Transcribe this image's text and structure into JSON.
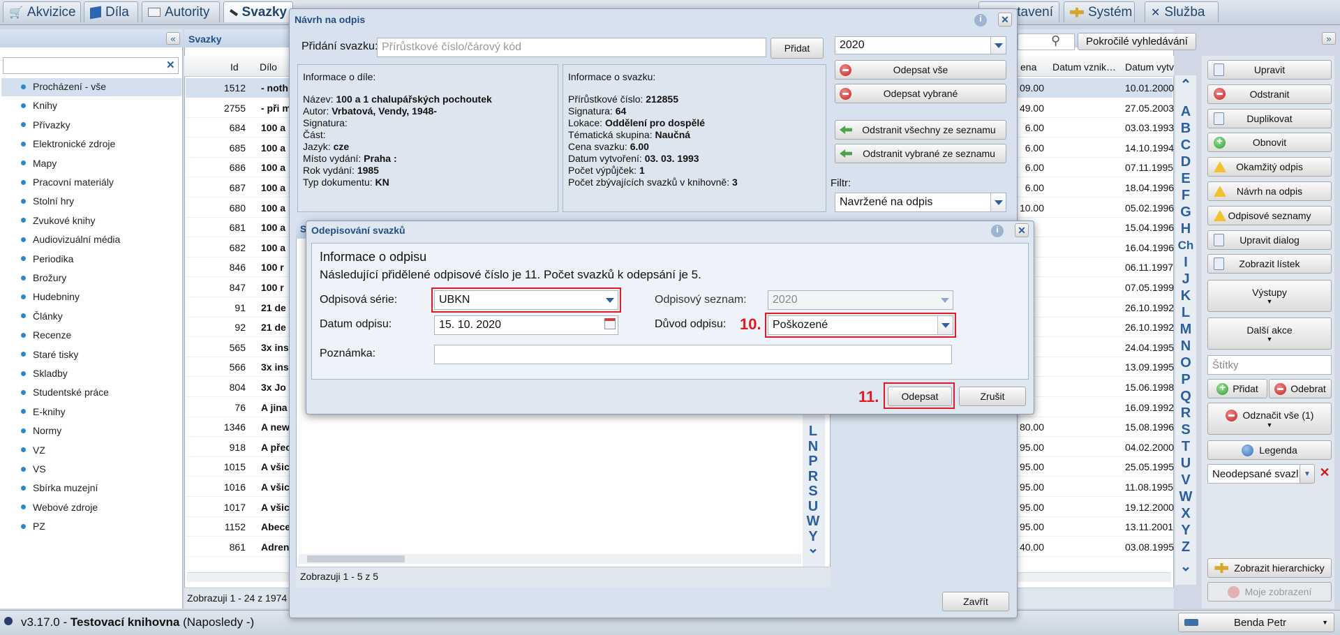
{
  "top_tabs": [
    {
      "label": "Akvizice",
      "icon": "cart-icon"
    },
    {
      "label": "Díla",
      "icon": "book-icon"
    },
    {
      "label": "Autority",
      "icon": "card-icon"
    },
    {
      "label": "Svazky",
      "icon": "pen-icon"
    }
  ],
  "top_tabs_right": [
    {
      "label": "stavení",
      "icon": "gear-icon"
    },
    {
      "label": "Systém",
      "icon": "key-icon"
    },
    {
      "label": "Služba",
      "icon": "tools-icon"
    }
  ],
  "sidebar": {
    "items": [
      "Procházení - vše",
      "Knihy",
      "Přívazky",
      "Elektronické zdroje",
      "Mapy",
      "Pracovní materiály",
      "Stolní hry",
      "Zvukové knihy",
      "Audiovizuální média",
      "Periodika",
      "Brožury",
      "Hudebniny",
      "Články",
      "Recenze",
      "Staré tisky",
      "Skladby",
      "Studentské práce",
      "E-knihy",
      "Normy",
      "VZ",
      "VS",
      "Sbírka muzejní",
      "Webové zdroje",
      "PZ"
    ]
  },
  "main": {
    "title": "Svazky",
    "columns": {
      "id": "Id",
      "dilo": "Dílo",
      "cena": "ena",
      "datum_vznik": "Datum vznik…",
      "datum_vytv": "Datum vytv"
    },
    "rows": [
      {
        "id": "1512",
        "dilo": "- noth",
        "cena": "09.00",
        "vytv": "10.01.2000"
      },
      {
        "id": "2755",
        "dilo": "- při m",
        "cena": "49.00",
        "vytv": "27.05.2003"
      },
      {
        "id": "684",
        "dilo": "100 a",
        "cena": "6.00",
        "vytv": "03.03.1993"
      },
      {
        "id": "685",
        "dilo": "100 a",
        "cena": "6.00",
        "vytv": "14.10.1994"
      },
      {
        "id": "686",
        "dilo": "100 a",
        "cena": "6.00",
        "vytv": "07.11.1995"
      },
      {
        "id": "687",
        "dilo": "100 a",
        "cena": "6.00",
        "vytv": "18.04.1996"
      },
      {
        "id": "680",
        "dilo": "100 a",
        "cena": "10.00",
        "vytv": "05.02.1996"
      },
      {
        "id": "681",
        "dilo": "100 a",
        "cena": "",
        "vytv": "15.04.1996"
      },
      {
        "id": "682",
        "dilo": "100 a",
        "cena": "",
        "vytv": "16.04.1996"
      },
      {
        "id": "846",
        "dilo": "100 r",
        "cena": "",
        "vytv": "06.11.1997"
      },
      {
        "id": "847",
        "dilo": "100 r",
        "cena": "",
        "vytv": "07.05.1999"
      },
      {
        "id": "91",
        "dilo": "21 de",
        "cena": "",
        "vytv": "26.10.1992"
      },
      {
        "id": "92",
        "dilo": "21 de",
        "cena": "",
        "vytv": "26.10.1992"
      },
      {
        "id": "565",
        "dilo": "3x ins",
        "cena": "",
        "vytv": "24.04.1995"
      },
      {
        "id": "566",
        "dilo": "3x ins",
        "cena": "",
        "vytv": "13.09.1995"
      },
      {
        "id": "804",
        "dilo": "3x Jo",
        "cena": "",
        "vytv": "15.06.1998"
      },
      {
        "id": "76",
        "dilo": "A jina",
        "cena": "",
        "vytv": "16.09.1992"
      },
      {
        "id": "1346",
        "dilo": "A new",
        "cena": "80.00",
        "vytv": "15.08.1996"
      },
      {
        "id": "918",
        "dilo": "A přec",
        "cena": "95.00",
        "vytv": "04.02.2000"
      },
      {
        "id": "1015",
        "dilo": "A všic",
        "cena": "95.00",
        "vytv": "25.05.1995"
      },
      {
        "id": "1016",
        "dilo": "A všic",
        "cena": "95.00",
        "vytv": "11.08.1995"
      },
      {
        "id": "1017",
        "dilo": "A všic",
        "cena": "95.00",
        "vytv": "19.12.2000"
      },
      {
        "id": "1152",
        "dilo": "Abece",
        "cena": "95.00",
        "vytv": "13.11.2001"
      },
      {
        "id": "861",
        "dilo": "Adren",
        "cena": "40.00",
        "vytv": "03.08.1995"
      }
    ],
    "footer": "Zobrazuji 1 - 24 z 1974"
  },
  "search": {
    "advanced_label": "Pokročilé vyhledávání"
  },
  "alphabet_outer": [
    "A",
    "B",
    "C",
    "D",
    "E",
    "F",
    "G",
    "H",
    "Ch",
    "I",
    "J",
    "K",
    "L",
    "M",
    "N",
    "O",
    "P",
    "Q",
    "R",
    "S",
    "T",
    "U",
    "V",
    "W",
    "X",
    "Y",
    "Z"
  ],
  "right_panel": {
    "buttons": [
      "Upravit",
      "Odstranit",
      "Duplikovat",
      "Obnovit",
      "Okamžitý odpis",
      "Návrh na odpis",
      "Odpisové seznamy",
      "Upravit dialog",
      "Zobrazit lístek"
    ],
    "vystupy": "Výstupy",
    "dalsi_akce": "Další akce",
    "stitky_placeholder": "Štítky",
    "pridat": "Přidat",
    "odebrat": "Odebrat",
    "oznacit": "Odznačit vše (1)",
    "legenda": "Legenda",
    "filter_value": "Neodepsané svazl",
    "hierarchy": "Zobrazit hierarchicky",
    "my_view": "Moje zobrazení"
  },
  "status": {
    "version": "v3.17.0 - ",
    "library": "Testovací knihovna",
    "last": " (Naposledy -)",
    "user": "Benda Petr"
  },
  "dialog1": {
    "title": "Návrh na odpis",
    "add_label": "Přidání svazku:",
    "add_placeholder": "Přírůstkové číslo/čárový kód",
    "add_button": "Přidat",
    "year": "2020",
    "btn_all": "Odepsat vše",
    "btn_selected": "Odepsat vybrané",
    "btn_remove_all": "Odstranit všechny ze seznamu",
    "btn_remove_sel": "Odstranit vybrané ze seznamu",
    "filter_label": "Filtr:",
    "filter_value": "Navržené na odpis",
    "work_info": {
      "header": "Informace o díle:",
      "lines": [
        {
          "k": "Název: ",
          "v": "100 a 1 chalupářských pochoutek"
        },
        {
          "k": "Autor: ",
          "v": "Vrbatová, Vendy, 1948-"
        },
        {
          "k": "Signatura:",
          "v": ""
        },
        {
          "k": "Část:",
          "v": ""
        },
        {
          "k": "Jazyk: ",
          "v": "cze"
        },
        {
          "k": "Místo vydání: ",
          "v": "Praha :"
        },
        {
          "k": "Rok vydání: ",
          "v": "1985"
        },
        {
          "k": "Typ dokumentu: ",
          "v": "KN"
        }
      ]
    },
    "vol_info": {
      "header": "Informace o svazku:",
      "lines": [
        {
          "k": "Přírůstkové číslo: ",
          "v": "212855"
        },
        {
          "k": "Signatura: ",
          "v": "64"
        },
        {
          "k": "Lokace: ",
          "v": "Oddělení pro dospělé"
        },
        {
          "k": "Tématická skupina: ",
          "v": "Naučná"
        },
        {
          "k": "Cena svazku: ",
          "v": "6.00"
        },
        {
          "k": "Datum vytvoření: ",
          "v": "03. 03. 1993"
        },
        {
          "k": "Počet výpůjček: ",
          "v": "1"
        },
        {
          "k": "Počet zbývajících svazků v knihovně: ",
          "v": "3"
        }
      ]
    },
    "inner_title_letter": "S",
    "inner_alphabet": [
      "L",
      "N",
      "P",
      "R",
      "S",
      "U",
      "W",
      "Y"
    ],
    "footer": "Zobrazuji 1 - 5 z 5",
    "close": "Zavřít"
  },
  "dialog2": {
    "title": "Odepisování svazků",
    "section": "Informace o odpisu",
    "desc": "Následující přidělené odpisové číslo je 11. Počet svazků k odepsání je 5.",
    "series_label": "Odpisová série:",
    "series_value": "UBKN",
    "list_label": "Odpisový seznam:",
    "list_value": "2020",
    "date_label": "Datum odpisu:",
    "date_value": "15. 10. 2020",
    "reason_label": "Důvod odpisu:",
    "reason_value": "Poškozené",
    "note_label": "Poznámka:",
    "note_value": "",
    "btn_ok": "Odepsat",
    "btn_cancel": "Zrušit",
    "step10": "10.",
    "step11": "11."
  },
  "colors": {
    "highlight": "#e01a22",
    "accent": "#2b5fa0"
  }
}
